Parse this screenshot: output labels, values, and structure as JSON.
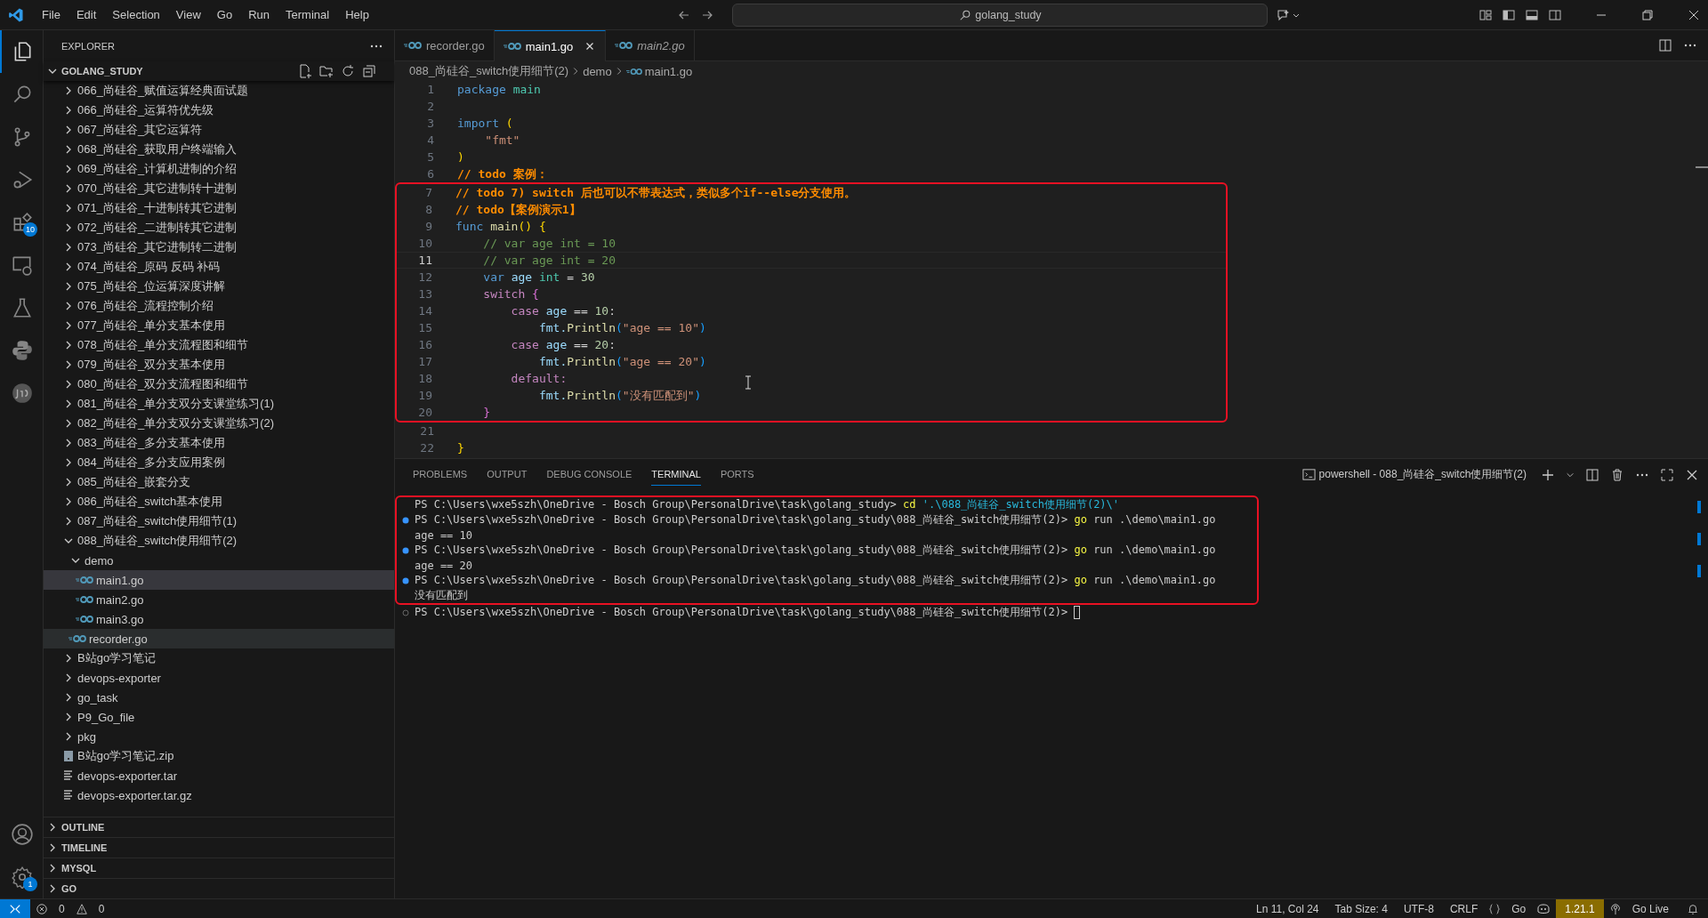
{
  "title_bar": {
    "menu": [
      "File",
      "Edit",
      "Selection",
      "View",
      "Go",
      "Run",
      "Terminal",
      "Help"
    ],
    "search": "golang_study"
  },
  "activity_bar": [
    {
      "kind": "explorer",
      "selected": true
    },
    {
      "kind": "search",
      "selected": false
    },
    {
      "kind": "source-control",
      "selected": false
    },
    {
      "kind": "run-debug",
      "selected": false
    },
    {
      "kind": "extensions",
      "selected": false,
      "badge": "10"
    },
    {
      "kind": "remote",
      "selected": false
    },
    {
      "kind": "testing",
      "selected": false
    },
    {
      "kind": "python",
      "selected": false
    },
    {
      "kind": "json",
      "selected": false
    }
  ],
  "activity_bottom": [
    {
      "kind": "account",
      "selected": false
    },
    {
      "kind": "settings",
      "selected": false,
      "badge": "1"
    }
  ],
  "sidebar": {
    "title": "EXPLORER",
    "root": "GOLANG_STUDY",
    "tree": [
      {
        "label": "066_尚硅谷_赋值运算经典面试题",
        "kind": "folder",
        "expanded": false,
        "selected": false,
        "hovered": false
      },
      {
        "label": "066_尚硅谷_运算符优先级",
        "kind": "folder",
        "expanded": false,
        "selected": false,
        "hovered": false
      },
      {
        "label": "067_尚硅谷_其它运算符",
        "kind": "folder",
        "expanded": false,
        "selected": false,
        "hovered": false
      },
      {
        "label": "068_尚硅谷_获取用户终端输入",
        "kind": "folder",
        "expanded": false,
        "selected": false,
        "hovered": false
      },
      {
        "label": "069_尚硅谷_计算机进制的介绍",
        "kind": "folder",
        "expanded": false,
        "selected": false,
        "hovered": false
      },
      {
        "label": "070_尚硅谷_其它进制转十进制",
        "kind": "folder",
        "expanded": false,
        "selected": false,
        "hovered": false
      },
      {
        "label": "071_尚硅谷_十进制转其它进制",
        "kind": "folder",
        "expanded": false,
        "selected": false,
        "hovered": false
      },
      {
        "label": "072_尚硅谷_二进制转其它进制",
        "kind": "folder",
        "expanded": false,
        "selected": false,
        "hovered": false
      },
      {
        "label": "073_尚硅谷_其它进制转二进制",
        "kind": "folder",
        "expanded": false,
        "selected": false,
        "hovered": false
      },
      {
        "label": "074_尚硅谷_原码 反码 补码",
        "kind": "folder",
        "expanded": false,
        "selected": false,
        "hovered": false
      },
      {
        "label": "075_尚硅谷_位运算深度讲解",
        "kind": "folder",
        "expanded": false,
        "selected": false,
        "hovered": false
      },
      {
        "label": "076_尚硅谷_流程控制介绍",
        "kind": "folder",
        "expanded": false,
        "selected": false,
        "hovered": false
      },
      {
        "label": "077_尚硅谷_单分支基本使用",
        "kind": "folder",
        "expanded": false,
        "selected": false,
        "hovered": false
      },
      {
        "label": "078_尚硅谷_单分支流程图和细节",
        "kind": "folder",
        "expanded": false,
        "selected": false,
        "hovered": false
      },
      {
        "label": "079_尚硅谷_双分支基本使用",
        "kind": "folder",
        "expanded": false,
        "selected": false,
        "hovered": false
      },
      {
        "label": "080_尚硅谷_双分支流程图和细节",
        "kind": "folder",
        "expanded": false,
        "selected": false,
        "hovered": false
      },
      {
        "label": "081_尚硅谷_单分支双分支课堂练习(1)",
        "kind": "folder",
        "expanded": false,
        "selected": false,
        "hovered": false
      },
      {
        "label": "082_尚硅谷_单分支双分支课堂练习(2)",
        "kind": "folder",
        "expanded": false,
        "selected": false,
        "hovered": false
      },
      {
        "label": "083_尚硅谷_多分支基本使用",
        "kind": "folder",
        "expanded": false,
        "selected": false,
        "hovered": false
      },
      {
        "label": "084_尚硅谷_多分支应用案例",
        "kind": "folder",
        "expanded": false,
        "selected": false,
        "hovered": false
      },
      {
        "label": "085_尚硅谷_嵌套分支",
        "kind": "folder",
        "expanded": false,
        "selected": false,
        "hovered": false
      },
      {
        "label": "086_尚硅谷_switch基本使用",
        "kind": "folder",
        "expanded": false,
        "selected": false,
        "hovered": false
      },
      {
        "label": "087_尚硅谷_switch使用细节(1)",
        "kind": "folder",
        "expanded": false,
        "selected": false,
        "hovered": false
      },
      {
        "label": "088_尚硅谷_switch使用细节(2)",
        "kind": "folder",
        "expanded": true,
        "selected": false,
        "hovered": false,
        "children": [
          {
            "label": "demo",
            "kind": "folder",
            "expanded": true,
            "selected": false,
            "hovered": false,
            "children": [
              {
                "label": "main1.go",
                "kind": "go",
                "selected": true,
                "hovered": false
              },
              {
                "label": "main2.go",
                "kind": "go",
                "selected": false,
                "hovered": false
              },
              {
                "label": "main3.go",
                "kind": "go",
                "selected": false,
                "hovered": false
              }
            ]
          },
          {
            "label": "recorder.go",
            "kind": "go",
            "selected": false,
            "hovered": true
          }
        ]
      },
      {
        "label": "B站go学习笔记",
        "kind": "folder",
        "expanded": false,
        "selected": false,
        "hovered": false
      },
      {
        "label": "devops-exporter",
        "kind": "folder",
        "expanded": false,
        "selected": false,
        "hovered": false
      },
      {
        "label": "go_task",
        "kind": "folder",
        "expanded": false,
        "selected": false,
        "hovered": false
      },
      {
        "label": "P9_Go_file",
        "kind": "folder",
        "expanded": false,
        "selected": false,
        "hovered": false
      },
      {
        "label": "pkg",
        "kind": "folder",
        "expanded": false,
        "selected": false,
        "hovered": false
      },
      {
        "label": "B站go学习笔记.zip",
        "kind": "zip",
        "selected": false,
        "hovered": false
      },
      {
        "label": "devops-exporter.tar",
        "kind": "text",
        "selected": false,
        "hovered": false
      },
      {
        "label": "devops-exporter.tar.gz",
        "kind": "text",
        "selected": false,
        "hovered": false
      }
    ],
    "sections": [
      "OUTLINE",
      "TIMELINE",
      "MYSQL",
      "GO"
    ]
  },
  "tabs": [
    {
      "label": "recorder.go",
      "selected": false,
      "preview": false
    },
    {
      "label": "main1.go",
      "selected": true,
      "preview": false
    },
    {
      "label": "main2.go",
      "selected": false,
      "preview": true
    }
  ],
  "breadcrumbs": [
    "088_尚硅谷_switch使用细节(2)",
    "demo",
    "main1.go"
  ],
  "code": [
    {
      "boxed": false,
      "lines": [
        {
          "n": "1",
          "current": false,
          "tokens": [
            {
              "kind": "kw",
              "t": "package "
            },
            {
              "kind": "type",
              "t": "main"
            }
          ]
        },
        {
          "n": "2",
          "current": false
        },
        {
          "n": "3",
          "current": false,
          "tokens": [
            {
              "kind": "kw",
              "t": "import "
            },
            {
              "kind": "br1",
              "t": "("
            }
          ]
        },
        {
          "n": "4",
          "current": false,
          "tokens": [
            {
              "kind": "str",
              "t": "    \"fmt\""
            }
          ]
        },
        {
          "n": "5",
          "current": false,
          "tokens": [
            {
              "kind": "br1",
              "t": ")"
            }
          ]
        },
        {
          "n": "6",
          "current": false,
          "tokens": [
            {
              "kind": "todo",
              "t": "// todo 案例："
            }
          ]
        }
      ]
    },
    {
      "boxed": true,
      "lines": [
        {
          "n": "7",
          "current": false,
          "tokens": [
            {
              "kind": "todo",
              "t": "// todo 7) switch 后也可以不带表达式，类似多个if--else分支使用。"
            }
          ]
        },
        {
          "n": "8",
          "current": false,
          "tokens": [
            {
              "kind": "todo",
              "t": "// todo【案例演示1】"
            }
          ]
        },
        {
          "n": "9",
          "current": false,
          "tokens": [
            {
              "kind": "kw",
              "t": "func "
            },
            {
              "kind": "fn",
              "t": "main"
            },
            {
              "kind": "br1",
              "t": "() {"
            }
          ]
        },
        {
          "n": "10",
          "current": false,
          "tokens": [
            {
              "kind": "cmt",
              "t": "    // var age int = 10"
            }
          ]
        },
        {
          "n": "11",
          "current": true,
          "tokens": [
            {
              "kind": "cmt",
              "t": "    // var age int = 20"
            }
          ]
        },
        {
          "n": "12",
          "current": false,
          "tokens": [
            {
              "kind": "kw",
              "t": "    var "
            },
            {
              "kind": "var",
              "t": "age "
            },
            {
              "kind": "type",
              "t": "int"
            },
            {
              "kind": "plain",
              "t": " = "
            },
            {
              "kind": "num",
              "t": "30"
            }
          ]
        },
        {
          "n": "13",
          "current": false,
          "tokens": [
            {
              "kind": "ctrl",
              "t": "    switch "
            },
            {
              "kind": "br2",
              "t": "{"
            }
          ]
        },
        {
          "n": "14",
          "current": false,
          "tokens": [
            {
              "kind": "ctrl",
              "t": "        case "
            },
            {
              "kind": "var",
              "t": "age"
            },
            {
              "kind": "plain",
              "t": " == "
            },
            {
              "kind": "num",
              "t": "10"
            },
            {
              "kind": "plain",
              "t": ":"
            }
          ]
        },
        {
          "n": "15",
          "current": false,
          "tokens": [
            {
              "kind": "pkg",
              "t": "            fmt."
            },
            {
              "kind": "fn",
              "t": "Println"
            },
            {
              "kind": "br3",
              "t": "("
            },
            {
              "kind": "str",
              "t": "\"age == 10\""
            },
            {
              "kind": "br3",
              "t": ")"
            }
          ]
        },
        {
          "n": "16",
          "current": false,
          "tokens": [
            {
              "kind": "ctrl",
              "t": "        case "
            },
            {
              "kind": "var",
              "t": "age"
            },
            {
              "kind": "plain",
              "t": " == "
            },
            {
              "kind": "num",
              "t": "20"
            },
            {
              "kind": "plain",
              "t": ":"
            }
          ]
        },
        {
          "n": "17",
          "current": false,
          "tokens": [
            {
              "kind": "pkg",
              "t": "            fmt."
            },
            {
              "kind": "fn",
              "t": "Println"
            },
            {
              "kind": "br3",
              "t": "("
            },
            {
              "kind": "str",
              "t": "\"age == 20\""
            },
            {
              "kind": "br3",
              "t": ")"
            }
          ]
        },
        {
          "n": "18",
          "current": false,
          "tokens": [
            {
              "kind": "ctrl",
              "t": "        default:"
            }
          ]
        },
        {
          "n": "19",
          "current": false,
          "tokens": [
            {
              "kind": "pkg",
              "t": "            fmt."
            },
            {
              "kind": "fn",
              "t": "Println"
            },
            {
              "kind": "br3",
              "t": "("
            },
            {
              "kind": "str",
              "t": "\"没有匹配到\""
            },
            {
              "kind": "br3",
              "t": ")"
            }
          ]
        },
        {
          "n": "20",
          "current": false,
          "tokens": [
            {
              "kind": "br2",
              "t": "    }"
            }
          ]
        }
      ]
    },
    {
      "boxed": false,
      "lines": [
        {
          "n": "21",
          "current": false
        },
        {
          "n": "22",
          "current": false,
          "tokens": [
            {
              "kind": "br1",
              "t": "}"
            }
          ]
        }
      ]
    }
  ],
  "panel": {
    "tabs": [
      {
        "label": "PROBLEMS",
        "selected": false
      },
      {
        "label": "OUTPUT",
        "selected": false
      },
      {
        "label": "DEBUG CONSOLE",
        "selected": false
      },
      {
        "label": "TERMINAL",
        "selected": true
      },
      {
        "label": "PORTS",
        "selected": false
      }
    ],
    "terminal_title": "powershell - 088_尚硅谷_switch使用细节(2)",
    "blocks": [
      {
        "boxed": true,
        "lines": [
          {
            "kind": "plain",
            "tokens": [
              {
                "kind": "plain",
                "t": "PS C:\\Users\\wxe5szh\\OneDrive - Bosch Group\\PersonalDrive\\task\\golang_study> "
              },
              {
                "kind": "cmd",
                "t": "cd"
              },
              {
                "kind": "arg",
                "t": " '.\\088_尚硅谷_switch使用细节(2)\\'"
              }
            ]
          },
          {
            "kind": "success",
            "tokens": [
              {
                "kind": "plain",
                "t": "PS C:\\Users\\wxe5szh\\OneDrive - Bosch Group\\PersonalDrive\\task\\golang_study\\088_尚硅谷_switch使用细节(2)> "
              },
              {
                "kind": "cmd",
                "t": "go"
              },
              {
                "kind": "plain",
                "t": " run .\\demo\\main1.go"
              }
            ]
          },
          {
            "kind": "plain",
            "tokens": [
              {
                "kind": "plain",
                "t": "age == 10"
              }
            ]
          },
          {
            "kind": "success",
            "tokens": [
              {
                "kind": "plain",
                "t": "PS C:\\Users\\wxe5szh\\OneDrive - Bosch Group\\PersonalDrive\\task\\golang_study\\088_尚硅谷_switch使用细节(2)> "
              },
              {
                "kind": "cmd",
                "t": "go"
              },
              {
                "kind": "plain",
                "t": " run .\\demo\\main1.go"
              }
            ]
          },
          {
            "kind": "plain",
            "tokens": [
              {
                "kind": "plain",
                "t": "age == 20"
              }
            ]
          },
          {
            "kind": "success",
            "tokens": [
              {
                "kind": "plain",
                "t": "PS C:\\Users\\wxe5szh\\OneDrive - Bosch Group\\PersonalDrive\\task\\golang_study\\088_尚硅谷_switch使用细节(2)> "
              },
              {
                "kind": "cmd",
                "t": "go"
              },
              {
                "kind": "plain",
                "t": " run .\\demo\\main1.go"
              }
            ]
          },
          {
            "kind": "plain",
            "tokens": [
              {
                "kind": "plain",
                "t": "没有匹配到"
              }
            ]
          }
        ]
      },
      {
        "boxed": false,
        "lines": [
          {
            "kind": "pending",
            "cursor": true,
            "tokens": [
              {
                "kind": "plain",
                "t": "PS C:\\Users\\wxe5szh\\OneDrive - Bosch Group\\PersonalDrive\\task\\golang_study\\088_尚硅谷_switch使用细节(2)> "
              }
            ]
          }
        ]
      }
    ]
  },
  "status_bar": {
    "errors": "0",
    "warnings": "0",
    "cursor": "Ln 11, Col 24",
    "tab_size": "Tab Size: 4",
    "encoding": "UTF-8",
    "eol": "CRLF",
    "language": "Go",
    "go_version": "1.21.1",
    "live": "Go Live"
  }
}
